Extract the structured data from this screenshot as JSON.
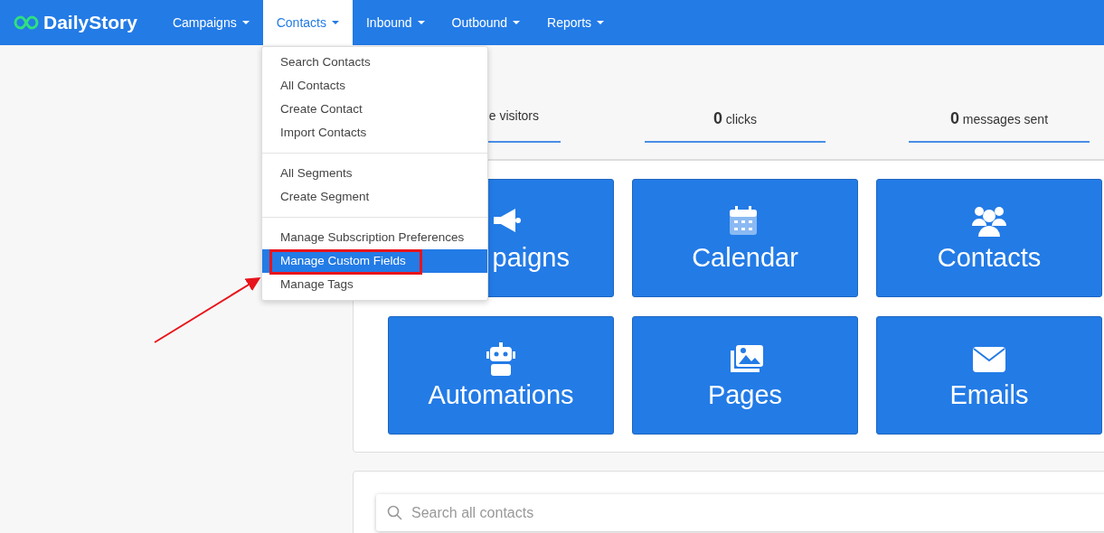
{
  "brand": {
    "name": "DailyStory"
  },
  "nav": [
    {
      "label": "Campaigns",
      "selected": false
    },
    {
      "label": "Contacts",
      "selected": true
    },
    {
      "label": "Inbound",
      "selected": false
    },
    {
      "label": "Outbound",
      "selected": false
    },
    {
      "label": "Reports",
      "selected": false
    }
  ],
  "dropdown": {
    "groups": [
      [
        {
          "label": "Search Contacts",
          "selected": false
        },
        {
          "label": "All Contacts",
          "selected": false
        },
        {
          "label": "Create Contact",
          "selected": false
        },
        {
          "label": "Import Contacts",
          "selected": false
        }
      ],
      [
        {
          "label": "All Segments",
          "selected": false
        },
        {
          "label": "Create Segment",
          "selected": false
        }
      ],
      [
        {
          "label": "Manage Subscription Preferences",
          "selected": false
        },
        {
          "label": "Manage Custom Fields",
          "selected": true
        },
        {
          "label": "Manage Tags",
          "selected": false
        }
      ]
    ]
  },
  "stats": [
    {
      "label": "e visitors"
    },
    {
      "value": "0",
      "label": "clicks"
    },
    {
      "value": "0",
      "label": "messages sent"
    }
  ],
  "tiles": [
    {
      "kind": "megaphone",
      "label": "paigns"
    },
    {
      "kind": "calendar",
      "label": "Calendar"
    },
    {
      "kind": "users",
      "label": "Contacts"
    },
    {
      "kind": "robot",
      "label": "Automations"
    },
    {
      "kind": "images",
      "label": "Pages"
    },
    {
      "kind": "envelope",
      "label": "Emails"
    }
  ],
  "search": {
    "placeholder": "Search all contacts"
  }
}
